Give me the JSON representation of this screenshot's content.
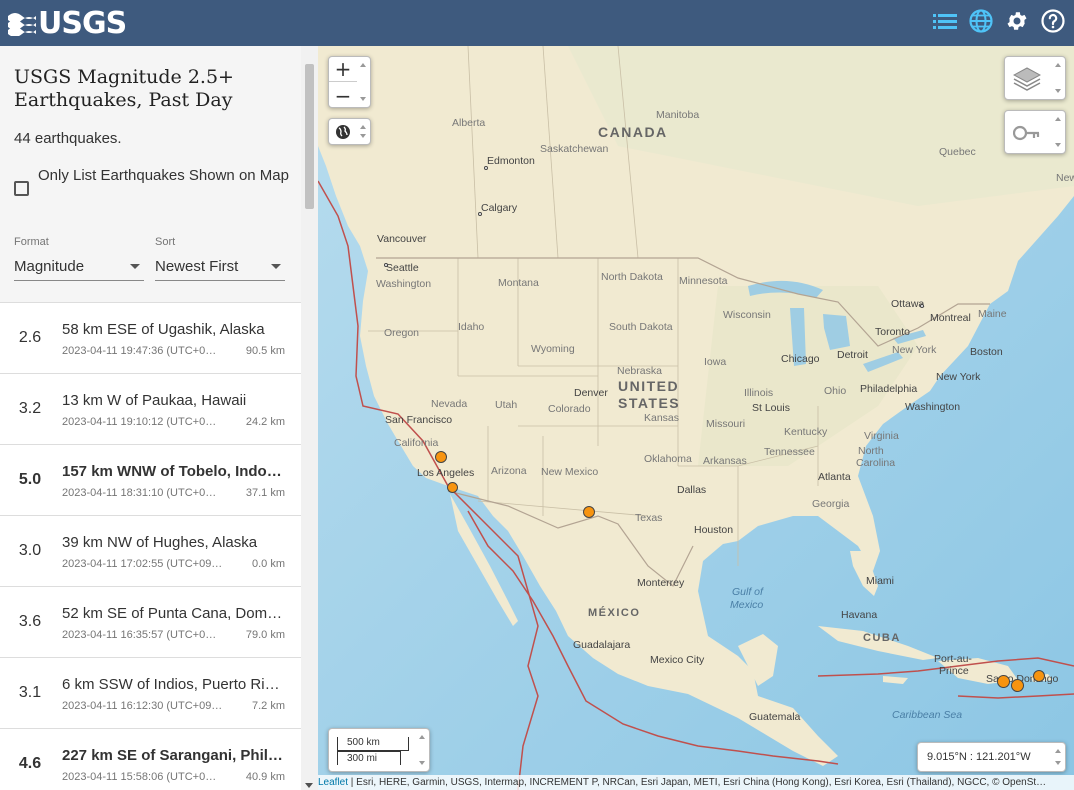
{
  "header": {
    "logo_text": "USGS",
    "icons": [
      "list-icon",
      "globe-icon",
      "gear-icon",
      "help-icon"
    ],
    "colors": {
      "background": "#3e5a7e",
      "active_icon": "#4fc3f7"
    }
  },
  "sidebar": {
    "title": "USGS Magnitude 2.5+ Earthquakes, Past Day",
    "count_text": "44 earthquakes.",
    "only_list_label": "Only List Earthquakes Shown on Map",
    "format_label": "Format",
    "format_value": "Magnitude",
    "sort_label": "Sort",
    "sort_value": "Newest First"
  },
  "earthquakes": [
    {
      "mag": "2.6",
      "place": "58 km ESE of Ugashik, Alaska",
      "time": "2023-04-11 19:47:36 (UTC+0…",
      "depth": "90.5 km",
      "bold": false
    },
    {
      "mag": "3.2",
      "place": "13 km W of Paukaa, Hawaii",
      "time": "2023-04-11 19:10:12 (UTC+0…",
      "depth": "24.2 km",
      "bold": false
    },
    {
      "mag": "5.0",
      "place": "157 km WNW of Tobelo, Indo…",
      "time": "2023-04-11 18:31:10 (UTC+0…",
      "depth": "37.1 km",
      "bold": true
    },
    {
      "mag": "3.0",
      "place": "39 km NW of Hughes, Alaska",
      "time": "2023-04-11 17:02:55 (UTC+09…",
      "depth": "0.0 km",
      "bold": false
    },
    {
      "mag": "3.6",
      "place": "52 km SE of Punta Cana, Dom…",
      "time": "2023-04-11 16:35:57 (UTC+0…",
      "depth": "79.0 km",
      "bold": false
    },
    {
      "mag": "3.1",
      "place": "6 km SSW of Indios, Puerto Ri…",
      "time": "2023-04-11 16:12:30 (UTC+09…",
      "depth": "7.2 km",
      "bold": false
    },
    {
      "mag": "4.6",
      "place": "227 km SE of Sarangani, Phil…",
      "time": "2023-04-11 15:58:06 (UTC+0…",
      "depth": "40.9 km",
      "bold": true
    }
  ],
  "map": {
    "zoom_in": "+",
    "zoom_out": "−",
    "scale_km": "500 km",
    "scale_mi": "300 mi",
    "coordinates": "9.015°N : 121.201°W",
    "attribution_leaflet": "Leaflet",
    "attribution_text": " | Esri, HERE, Garmin, USGS, Intermap, INCREMENT P, NRCan, Esri Japan, METI, Esri China (Hong Kong), Esri Korea, Esri (Thailand), NGCC, © OpenSt…",
    "labels": {
      "canada": "CANADA",
      "united_states_1": "UNITED",
      "united_states_2": "STATES",
      "mexico": "MÉXICO",
      "cuba": "CUBA",
      "alberta": "Alberta",
      "manitoba": "Manitoba",
      "saskatchewan": "Saskatchewan",
      "quebec": "Quebec",
      "new": "New",
      "edmonton": "Edmonton",
      "calgary": "Calgary",
      "vancouver": "Vancouver",
      "seattle": "Seattle",
      "washington_state": "Washington",
      "montana": "Montana",
      "north_dakota": "North Dakota",
      "minnesota": "Minnesota",
      "ottawa": "Ottawa",
      "montreal": "Montreal",
      "maine": "Maine",
      "toronto": "Toronto",
      "oregon": "Oregon",
      "idaho": "Idaho",
      "south_dakota": "South Dakota",
      "wisconsin": "Wisconsin",
      "detroit": "Detroit",
      "new_york_state": "New York",
      "boston": "Boston",
      "wyoming": "Wyoming",
      "nebraska": "Nebraska",
      "iowa": "Iowa",
      "chicago": "Chicago",
      "new_york": "New York",
      "philadelphia": "Philadelphia",
      "nevada": "Nevada",
      "utah": "Utah",
      "denver": "Denver",
      "illinois": "Illinois",
      "ohio": "Ohio",
      "washington_dc": "Washington",
      "san_francisco": "San Francisco",
      "colorado": "Colorado",
      "kansas": "Kansas",
      "st_louis": "St Louis",
      "missouri": "Missouri",
      "kentucky": "Kentucky",
      "virginia": "Virginia",
      "california": "California",
      "oklahoma": "Oklahoma",
      "arkansas": "Arkansas",
      "tennessee": "Tennessee",
      "north_carolina_1": "North",
      "north_carolina_2": "Carolina",
      "los_angeles": "Los Angeles",
      "arizona": "Arizona",
      "new_mexico": "New Mexico",
      "dallas": "Dallas",
      "atlanta": "Atlanta",
      "georgia": "Georgia",
      "texas": "Texas",
      "houston": "Houston",
      "monterrey": "Monterrey",
      "miami": "Miami",
      "gulf_1": "Gulf of",
      "gulf_2": "Mexico",
      "havana": "Havana",
      "guadalajara": "Guadalajara",
      "mexico_city": "Mexico City",
      "port_au_prince_1": "Port-au-",
      "port_au_prince_2": "Prince",
      "santo_domingo": "Santo Domingo",
      "guatemala": "Guatemala",
      "caribbean": "Caribbean Sea"
    }
  }
}
